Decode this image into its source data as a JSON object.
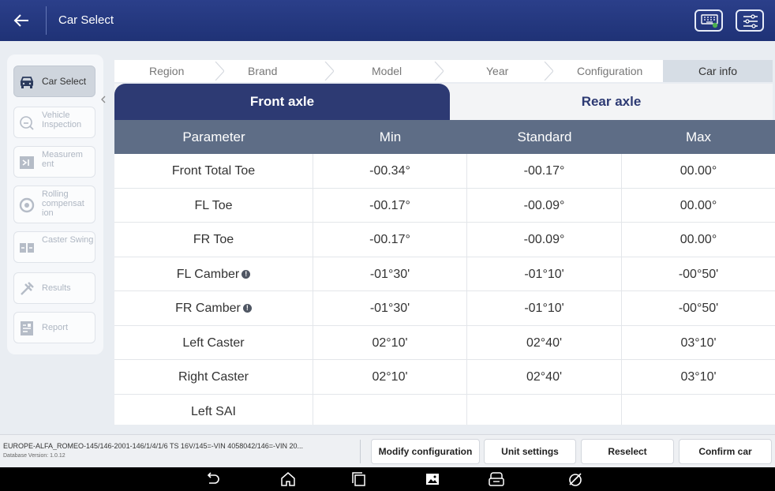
{
  "header": {
    "back_icon": "arrow-left-icon",
    "title": "Car Select",
    "keyboard_icon": "vci-keyboard-icon",
    "settings_icon": "sliders-icon"
  },
  "sidebar": {
    "collapse_icon": "chevron-left-icon",
    "items": [
      {
        "label": "Car Select",
        "icon": "car-icon",
        "active": true
      },
      {
        "label": "Vehicle Inspection",
        "icon": "inspection-icon",
        "active": false
      },
      {
        "label": "Measurem ent",
        "icon": "measurement-icon",
        "active": false
      },
      {
        "label": "Rolling compensat ion",
        "icon": "rolling-icon",
        "active": false
      },
      {
        "label": "Caster Swing",
        "icon": "caster-icon",
        "active": false
      },
      {
        "label": "Results",
        "icon": "results-icon",
        "active": false
      },
      {
        "label": "Report",
        "icon": "report-icon",
        "active": false
      }
    ]
  },
  "breadcrumb": [
    "Region",
    "Brand",
    "Model",
    "Year",
    "Configuration",
    "Car info"
  ],
  "tabs": {
    "front": "Front axle",
    "rear": "Rear axle"
  },
  "table": {
    "headers": [
      "Parameter",
      "Min",
      "Standard",
      "Max"
    ],
    "rows": [
      {
        "param": "Front Total Toe",
        "min": "-00.34°",
        "std": "-00.17°",
        "max": "00.00°",
        "info": false
      },
      {
        "param": "FL Toe",
        "min": "-00.17°",
        "std": "-00.09°",
        "max": "00.00°",
        "info": false
      },
      {
        "param": "FR Toe",
        "min": "-00.17°",
        "std": "-00.09°",
        "max": "00.00°",
        "info": false
      },
      {
        "param": "FL Camber",
        "min": "-01°30'",
        "std": "-01°10'",
        "max": "-00°50'",
        "info": true
      },
      {
        "param": "FR Camber",
        "min": "-01°30'",
        "std": "-01°10'",
        "max": "-00°50'",
        "info": true
      },
      {
        "param": "Left Caster",
        "min": "02°10'",
        "std": "02°40'",
        "max": "03°10'",
        "info": false
      },
      {
        "param": "Right Caster",
        "min": "02°10'",
        "std": "02°40'",
        "max": "03°10'",
        "info": false
      },
      {
        "param": "Left SAI",
        "min": "",
        "std": "",
        "max": "",
        "info": false
      }
    ],
    "info_symbol": "!"
  },
  "footer": {
    "vehicle_info": "EUROPE-ALFA_ROMEO-145/146-2001-146/1/4/1/6 TS 16V/145=-VIN 4058042/146=-VIN 20...",
    "db_version": "Database Version: 1.0.12",
    "buttons": [
      "Modify configuration",
      "Unit settings",
      "Reselect",
      "Confirm car"
    ]
  },
  "navbar": {
    "icons": [
      "back-nav-icon",
      "home-nav-icon",
      "recents-nav-icon",
      "gallery-nav-icon",
      "vci-nav-icon",
      "browser-nav-icon"
    ]
  },
  "colors": {
    "header": "#1f3276",
    "active_tab": "#2d3a73",
    "table_header": "#5e6d86"
  }
}
